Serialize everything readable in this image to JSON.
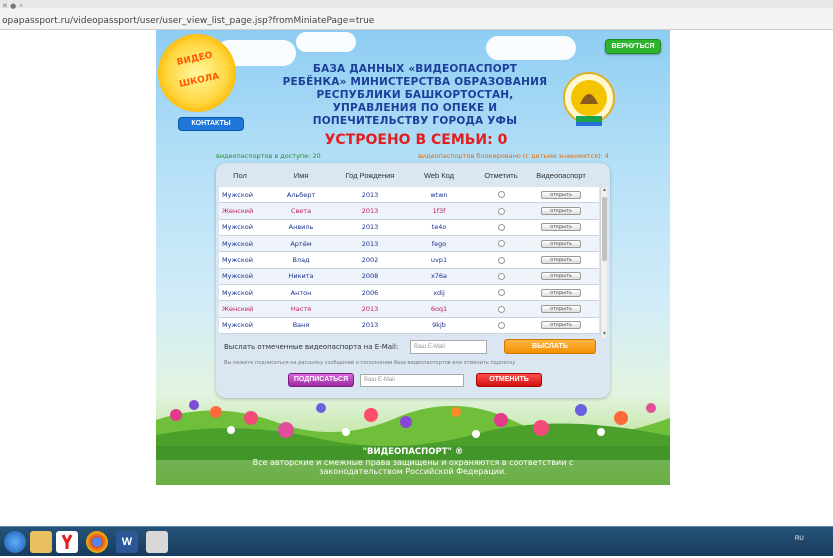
{
  "browser": {
    "url": "opapassport.ru/videopassport/user/user_view_list_page.jsp?fromMiniatePage=true"
  },
  "site": {
    "logo_text": "ВИДЕО ШКОЛА",
    "back_label": "ВЕРНУТЬСЯ",
    "header_title": "БАЗА ДАННЫХ «ВИДЕОПАСПОРТ РЕБЁНКА» МИНИСТЕРСТВА ОБРАЗОВАНИЯ РЕСПУБЛИКИ БАШКОРТОСТАН, УПРАВЛЕНИЯ ПО ОПЕКЕ И ПОПЕЧИТЕЛЬСТВУ ГОРОДА УФЫ",
    "contacts_label": "КОНТАКТЫ",
    "placed_text": "УСТРОЕНО В СЕМЬИ: 0",
    "available_text": "видеопаспортов в доступе: 20",
    "blocked_text": "видеопаспортов блокировано (с детьми знакомятся): 4",
    "colors": {
      "accent_blue": "#1f78d9",
      "title_blue": "#1b3f9a",
      "placed_red": "#e41e1e",
      "available_green": "#2a8a2a",
      "blocked_orange": "#e86a00"
    }
  },
  "table": {
    "headers": [
      "Пол",
      "Имя",
      "Год Рождения",
      "Web Код",
      "Отметить",
      "Видеопаспорт"
    ],
    "open_label": "открыть",
    "rows": [
      {
        "sex": "Мужской",
        "name": "Альберт",
        "year": "2013",
        "code": "wtwn",
        "gender": "m"
      },
      {
        "sex": "Женский",
        "name": "Света",
        "year": "2013",
        "code": "1f3f",
        "gender": "f"
      },
      {
        "sex": "Мужской",
        "name": "Анвиль",
        "year": "2013",
        "code": "te4o",
        "gender": "m"
      },
      {
        "sex": "Мужской",
        "name": "Артём",
        "year": "2013",
        "code": "fego",
        "gender": "m"
      },
      {
        "sex": "Мужской",
        "name": "Влад",
        "year": "2002",
        "code": "uvp1",
        "gender": "m"
      },
      {
        "sex": "Мужской",
        "name": "Никита",
        "year": "2008",
        "code": "x76a",
        "gender": "m"
      },
      {
        "sex": "Мужской",
        "name": "Антон",
        "year": "2006",
        "code": "xdij",
        "gender": "m"
      },
      {
        "sex": "Женский",
        "name": "Настя",
        "year": "2013",
        "code": "6oq1",
        "gender": "f"
      },
      {
        "sex": "Мужской",
        "name": "Ваня",
        "year": "2013",
        "code": "9kjb",
        "gender": "m"
      }
    ]
  },
  "email": {
    "send_label": "Выслать отмеченные видеопаспорта на E-Mail:",
    "send_placeholder": "Ваш E-Mail",
    "send_button": "ВЫСЛАТЬ",
    "note": "Вы можете подписаться на рассылку сообщений о пополнении база видеопаспортов или отменить подписку",
    "subscribe_button": "ПОДПИСАТЬСЯ",
    "subscribe_placeholder": "Ваш E-Mail",
    "unsubscribe_button": "ОТМЕНИТЬ"
  },
  "footer": {
    "line1": "\"ВИДЕОПАСПОРТ\" ®",
    "line2": "Все авторские и смежные права защищены и охраняются в соответствии с",
    "line3": "законодательством Российской Федерации."
  },
  "taskbar": {
    "tray_text": "RU",
    "icons": [
      "start-icon",
      "explorer-icon",
      "media-icon",
      "yandex-icon",
      "chrome-icon",
      "word-icon",
      "paint-icon"
    ]
  }
}
